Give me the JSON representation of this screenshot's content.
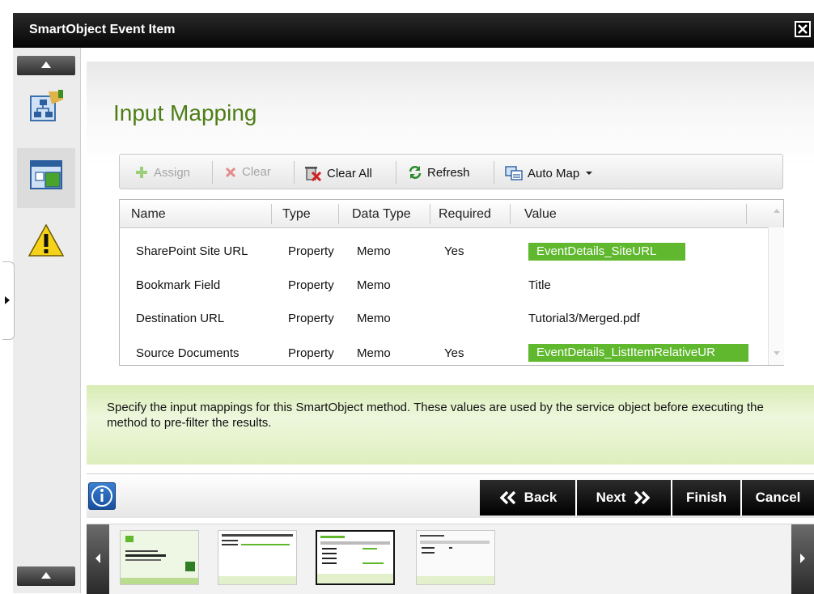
{
  "window": {
    "title": "SmartObject Event Item"
  },
  "sidebar": {
    "items": [
      {
        "icon": "hierarchy-map-icon"
      },
      {
        "icon": "form-window-icon"
      },
      {
        "icon": "warning-icon"
      }
    ]
  },
  "page": {
    "heading": "Input Mapping"
  },
  "toolbar": {
    "assign": "Assign",
    "clear": "Clear",
    "clear_all": "Clear All",
    "refresh": "Refresh",
    "auto_map": "Auto Map"
  },
  "grid": {
    "columns": [
      "Name",
      "Type",
      "Data Type",
      "Required",
      "Value"
    ],
    "rows": [
      {
        "name": "SharePoint Site URL",
        "type": "Property",
        "data_type": "Memo",
        "required": "Yes",
        "value": "EventDetails_SiteURL",
        "value_is_field": true
      },
      {
        "name": "Bookmark Field",
        "type": "Property",
        "data_type": "Memo",
        "required": "",
        "value": "Title",
        "value_is_field": false
      },
      {
        "name": "Destination URL",
        "type": "Property",
        "data_type": "Memo",
        "required": "",
        "value": "Tutorial3/Merged.pdf",
        "value_is_field": false
      },
      {
        "name": "Source Documents",
        "type": "Property",
        "data_type": "Memo",
        "required": "Yes",
        "value": "EventDetails_ListItemRelativeUR",
        "value_is_field": true
      }
    ]
  },
  "info": {
    "text": "Specify the input mappings for this SmartObject method. These values are used by the service object before executing the method to pre-filter the results."
  },
  "actions": {
    "back": "Back",
    "next": "Next",
    "finish": "Finish",
    "cancel": "Cancel"
  },
  "thumbnails": {
    "count": 4,
    "selected_index": 2
  },
  "colors": {
    "accent_green": "#5fb82d",
    "heading_green": "#4e7d16",
    "title_bar": "#000000"
  }
}
